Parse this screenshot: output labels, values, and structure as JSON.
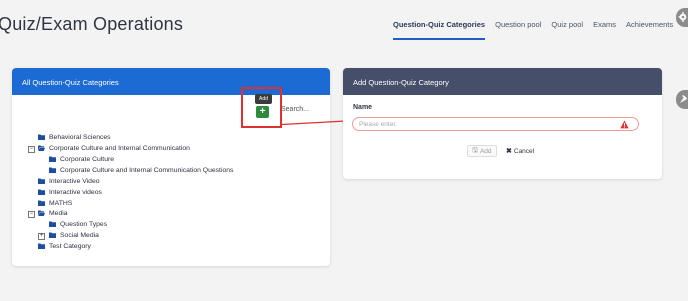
{
  "header": {
    "title": "Quiz/Exam Operations",
    "tabs": [
      {
        "label": "Question-Quiz Categories",
        "active": true
      },
      {
        "label": "Question pool",
        "active": false
      },
      {
        "label": "Quiz pool",
        "active": false
      },
      {
        "label": "Exams",
        "active": false
      },
      {
        "label": "Achievements",
        "active": false
      }
    ]
  },
  "left_panel": {
    "title": "All Question-Quiz Categories",
    "add_tooltip": "Add",
    "add_icon": "plus-icon",
    "search_placeholder": "Search...",
    "tree": [
      {
        "label": "Behavioral Sciences",
        "level": 0,
        "toggle": null
      },
      {
        "label": "Corporate Culture and Internal Communication",
        "level": 0,
        "toggle": "−"
      },
      {
        "label": "Corporate Culture",
        "level": 1,
        "toggle": null
      },
      {
        "label": "Corporate Culture and Internal Communication Questions",
        "level": 1,
        "toggle": null
      },
      {
        "label": "Interactive Video",
        "level": 0,
        "toggle": null
      },
      {
        "label": "Interactive videos",
        "level": 0,
        "toggle": null
      },
      {
        "label": "MATHS",
        "level": 0,
        "toggle": null
      },
      {
        "label": "Media",
        "level": 0,
        "toggle": "−"
      },
      {
        "label": "Question Types",
        "level": 1,
        "toggle": null
      },
      {
        "label": "Social Media",
        "level": 1,
        "toggle": "+"
      },
      {
        "label": "Test Category",
        "level": 0,
        "toggle": null
      }
    ]
  },
  "right_panel": {
    "title": "Add Question-Quiz Category",
    "name_label": "Name",
    "name_placeholder": "Please enter.",
    "name_value": "",
    "add_label": "Add",
    "cancel_label": "Cancel"
  },
  "colors": {
    "primary": "#1c6ad3",
    "dark_header": "#454f6a",
    "success": "#2e8b3e",
    "error": "#e03131"
  }
}
